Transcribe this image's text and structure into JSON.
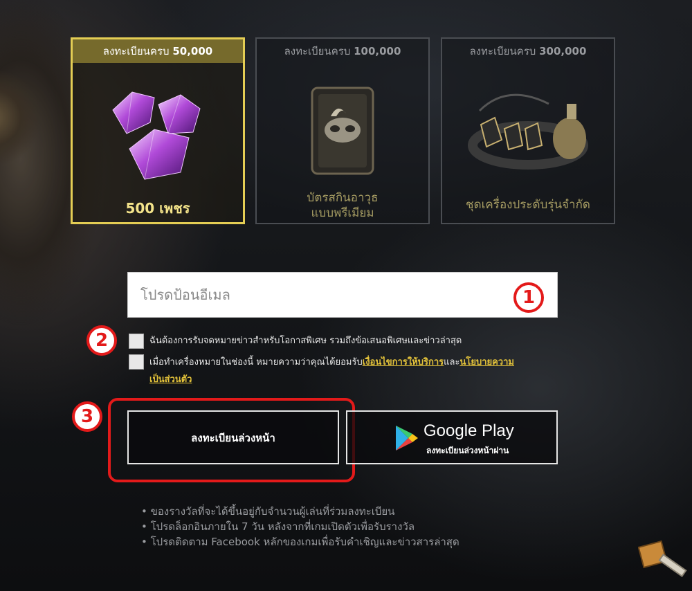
{
  "rewards": [
    {
      "head_text": "ลงทะเบียนครบ",
      "head_num": "50,000",
      "title_line1": "500 เพชร",
      "title_line2": "",
      "icon": "diamond-icon"
    },
    {
      "head_text": "ลงทะเบียนครบ",
      "head_num": "100,000",
      "title_line1": "บัตรสกินอาวุธ",
      "title_line2": "แบบพรีเมียม",
      "icon": "mask-card-icon"
    },
    {
      "head_text": "ลงทะเบียนครบ",
      "head_num": "300,000",
      "title_line1": "ชุดเครื่องประดับรุ่นจำกัด",
      "title_line2": "",
      "icon": "necklace-ring-icon"
    }
  ],
  "form": {
    "email_placeholder": "โปรดป้อนอีเมล",
    "marker1": "1",
    "marker2": "2",
    "marker3": "3",
    "consent1": "ฉันต้องการรับจดหมายข่าวสำหรับโอกาสพิเศษ รวมถึงข้อเสนอพิเศษและข่าวล่าสุด",
    "consent2_prefix": "เมื่อทำเครื่องหมายในช่องนี้ หมายความว่าคุณได้ยอมรับ",
    "consent2_link1": "เงื่อนไขการให้บริการ",
    "consent2_mid": "และ",
    "consent2_link2a": "นโยบายความ",
    "consent2_link2b": "เป็นส่วนตัว"
  },
  "buttons": {
    "register": "ลงทะเบียนล่วงหน้า",
    "google_play_brand": "Google Play",
    "google_play_sub": "ลงทะเบียนล่วงหน้าผ่าน"
  },
  "notes": [
    "ของรางวัลที่จะได้ขึ้นอยู่กับจำนวนผู้เล่นที่ร่วมลงทะเบียน",
    "โปรดล็อกอินภายใน 7 วัน หลังจากที่เกมเปิดตัวเพื่อรับรางวัล",
    "โปรดติดตาม Facebook หลักของเกมเพื่อรับคำเชิญและข่าวสารล่าสุด"
  ],
  "colors": {
    "accent_gold": "#e4cd54",
    "marker_red": "#e31a1a"
  }
}
